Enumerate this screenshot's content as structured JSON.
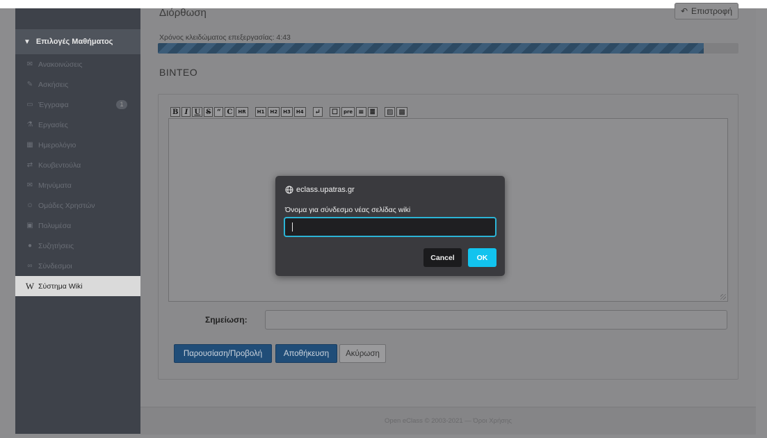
{
  "sidebar": {
    "header_label": "Επιλογές Μαθήματος",
    "items": [
      {
        "icon": "megaphone-icon",
        "glyph": "✉",
        "label": "Ανακοινώσεις"
      },
      {
        "icon": "edit-icon",
        "glyph": "✎",
        "label": "Ασκήσεις"
      },
      {
        "icon": "folder-icon",
        "glyph": "▭",
        "label": "Έγγραφα",
        "badge": "1"
      },
      {
        "icon": "flask-icon",
        "glyph": "⚗",
        "label": "Εργασίες"
      },
      {
        "icon": "calendar-icon",
        "glyph": "▦",
        "label": "Ημερολόγιο"
      },
      {
        "icon": "exchange-icon",
        "glyph": "⇄",
        "label": "Κουβεντούλα"
      },
      {
        "icon": "envelope-icon",
        "glyph": "✉",
        "label": "Μηνύματα"
      },
      {
        "icon": "users-icon",
        "glyph": "☺",
        "label": "Ομάδες Χρηστών"
      },
      {
        "icon": "film-icon",
        "glyph": "▣",
        "label": "Πολυμέσα"
      },
      {
        "icon": "comments-icon",
        "glyph": "●",
        "label": "Συζητήσεις"
      },
      {
        "icon": "link-icon",
        "glyph": "∞",
        "label": "Σύνδεσμοι"
      },
      {
        "icon": "wikipedia-icon",
        "glyph": "W",
        "label": "Σύστημα Wiki",
        "active": true
      }
    ]
  },
  "page": {
    "title": "Διόρθωση",
    "back_label": "Επιστροφή",
    "lock_text": "Χρόνος κλειδώματος επεξεργασίας: 4:43",
    "lock_progress": 0.94,
    "section_title": "ΒΙΝΤΕΟ"
  },
  "toolbar": [
    {
      "name": "bold",
      "label": "B"
    },
    {
      "name": "italic",
      "label": "I"
    },
    {
      "name": "underline",
      "label": "U"
    },
    {
      "name": "strike",
      "label": "S"
    },
    {
      "name": "quote",
      "label": "“"
    },
    {
      "name": "code",
      "label": "C"
    },
    {
      "name": "hr",
      "label": "HR",
      "small": true
    },
    {
      "gap": true
    },
    {
      "name": "h1",
      "label": "H1",
      "small": true
    },
    {
      "name": "h2",
      "label": "H2",
      "small": true
    },
    {
      "name": "h3",
      "label": "H3",
      "small": true
    },
    {
      "name": "h4",
      "label": "H4",
      "small": true
    },
    {
      "gap": true
    },
    {
      "name": "linebreak",
      "label": "↵"
    },
    {
      "gap": true
    },
    {
      "name": "comment",
      "label": "☐"
    },
    {
      "name": "pre",
      "label": "pre",
      "small": true
    },
    {
      "name": "bullet-list",
      "label": "≡"
    },
    {
      "name": "numbered-list",
      "label": "≣"
    },
    {
      "gap": true
    },
    {
      "name": "image",
      "label": "▨"
    },
    {
      "name": "wiki-link",
      "label": "▩"
    }
  ],
  "form": {
    "note_label": "Σημείωση:",
    "note_value": "",
    "preview_label": "Παρουσίαση/Προβολή",
    "save_label": "Αποθήκευση",
    "cancel_label": "Ακύρωση"
  },
  "footer": {
    "text": "Open eClass © 2003-2021 — Όροι Χρήσης"
  },
  "dialog": {
    "origin": "eclass.upatras.gr",
    "message": "Όνομα για σύνδεσμο νέας σελίδας wiki",
    "input_value": "",
    "cancel_label": "Cancel",
    "ok_label": "OK",
    "accent": "#12c3ee"
  }
}
